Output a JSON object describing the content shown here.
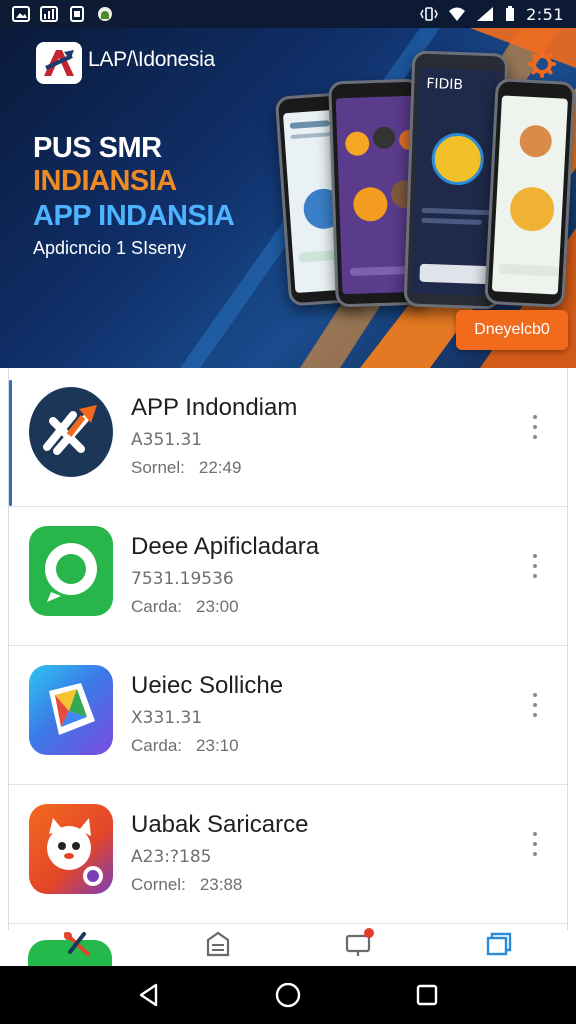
{
  "status_bar": {
    "time": "2:51",
    "left_icons": [
      "image-icon",
      "chart-icon",
      "file-icon",
      "android-icon"
    ],
    "right_icons": [
      "vibrate-icon",
      "wifi-icon",
      "signal-icon",
      "battery-icon"
    ]
  },
  "header": {
    "brand": "LAP/\\Idonesia",
    "settings_icon": "gear-icon"
  },
  "hero": {
    "line1": "PUS SMR",
    "line2": "INDIANSIA",
    "line3": "APP INDANSIA",
    "subtitle": "Apdicncio 1 SIseny",
    "cta_label": "Dneyelcb0",
    "phone_title": "FIDIB",
    "colors": {
      "orange": "#f26b1d",
      "blue_text": "#4fb3ff",
      "orange_text": "#f08a24"
    }
  },
  "apps": [
    {
      "title": "APP Indondiam",
      "code": "A351.31",
      "meta_label": "Sornel:",
      "meta_time": "22:49",
      "icon": "arrows-logo-icon"
    },
    {
      "title": "Deee Apificladara",
      "code": "7531.19536",
      "meta_label": "Carda:",
      "meta_time": "23:00",
      "icon": "chat-bubble-icon"
    },
    {
      "title": "Ueiec Solliche",
      "code": "X331.31",
      "meta_label": "Carda:",
      "meta_time": "23:10",
      "icon": "play-store-icon"
    },
    {
      "title": "Uabak Saricarce",
      "code": "A23:?185",
      "meta_label": "Cornel:",
      "meta_time": "23:88",
      "icon": "cartoon-cat-icon"
    }
  ],
  "tabs": [
    {
      "name": "tab-home",
      "icon": "tools-icon"
    },
    {
      "name": "tab-inbox",
      "icon": "inbox-icon"
    },
    {
      "name": "tab-notifications",
      "icon": "notification-icon"
    },
    {
      "name": "tab-windows",
      "icon": "windows-icon"
    }
  ],
  "nav": [
    "back-icon",
    "home-icon",
    "recents-icon"
  ]
}
